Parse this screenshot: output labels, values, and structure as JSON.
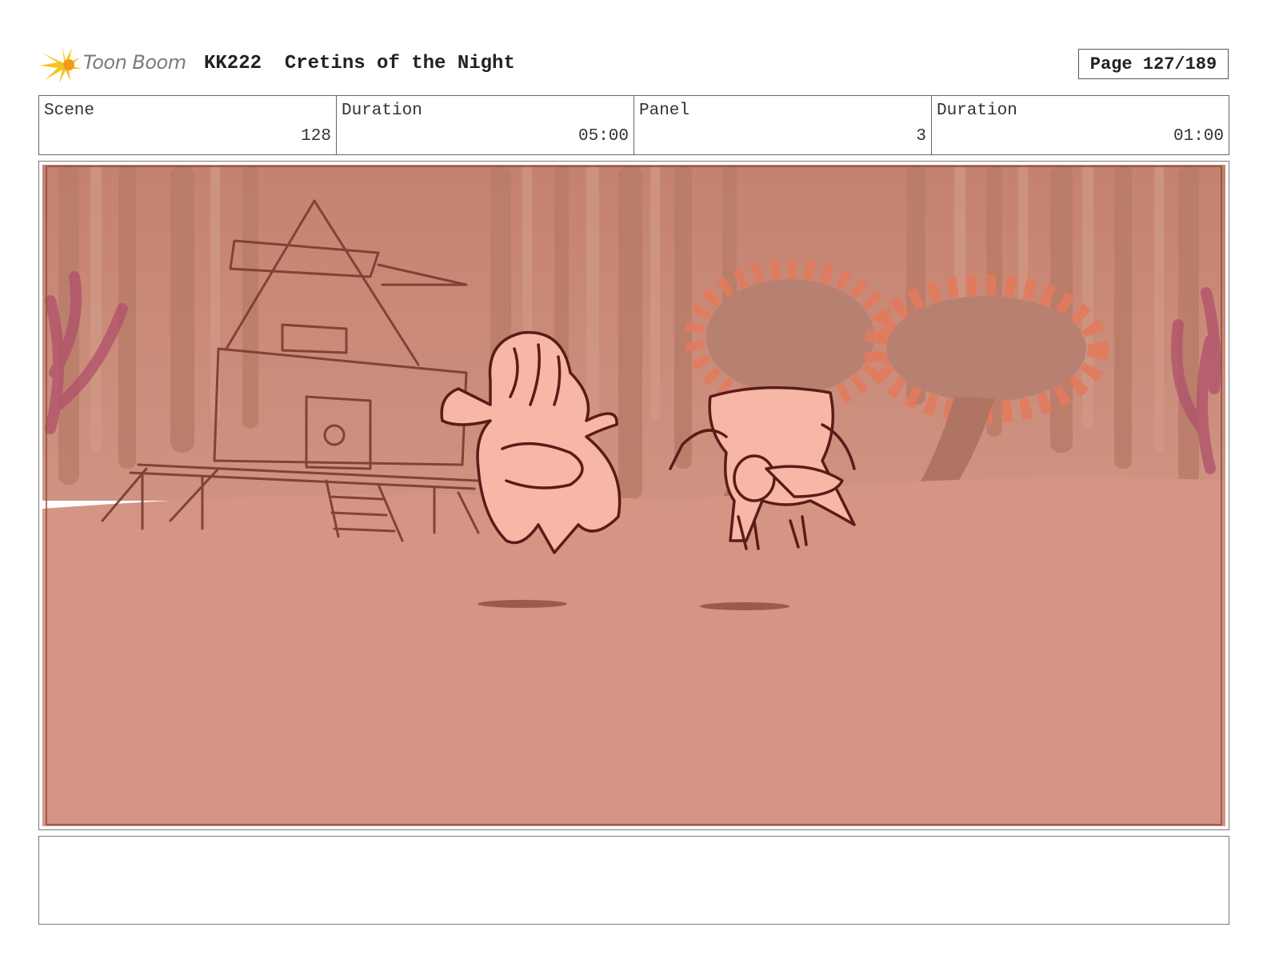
{
  "header": {
    "logo_text": "Toon Boom",
    "title": "KK222  Cretins of the Night",
    "page": "Page 127/189"
  },
  "info": {
    "scene_label": "Scene",
    "scene_value": "128",
    "duration_label": "Duration",
    "duration_value": "05:00",
    "panel_label": "Panel",
    "panel_value": "3",
    "panel_duration_label": "Duration",
    "panel_duration_value": "01:00"
  },
  "notes": {
    "text": ""
  },
  "colors": {
    "sky": "#c98f7c",
    "ground": "#d49585",
    "stalk": "#b47a68",
    "character_fill": "#f6b7a6",
    "line": "#5a1c18",
    "flower_petals": "#e27a5c",
    "mushroom": "#b88070"
  },
  "icons": {
    "logo": "toon-boom-flare-icon"
  }
}
